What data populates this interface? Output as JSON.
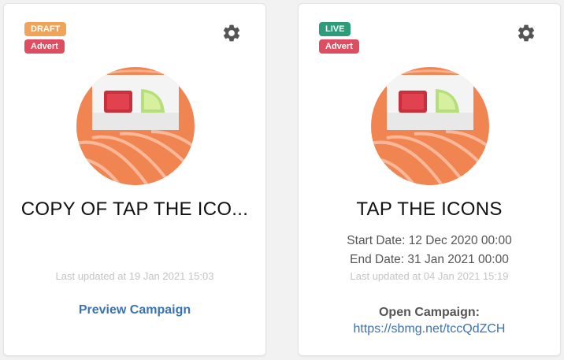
{
  "colors": {
    "draft_badge": "#f0a45a",
    "live_badge": "#2e9c78",
    "advert_badge": "#dd4f60",
    "link": "#3a73b5",
    "salmon": "#f08552"
  },
  "cards": [
    {
      "status_badge": "DRAFT",
      "type_badge": "Advert",
      "icon": "gear-icon",
      "image": "sushi-roll-image",
      "title": "COPY OF TAP THE ICO...",
      "last_updated": "Last updated at 19 Jan 2021 15:03",
      "action_label": "Preview Campaign"
    },
    {
      "status_badge": "LIVE",
      "type_badge": "Advert",
      "icon": "gear-icon",
      "image": "sushi-roll-image",
      "title": "TAP THE ICONS",
      "start_date": "Start Date: 12 Dec 2020 00:00",
      "end_date": "End Date: 31 Jan 2021 00:00",
      "last_updated": "Last updated at 04 Jan 2021 15:19",
      "open_label": "Open Campaign:",
      "open_url": "https://sbmg.net/tccQdZCH"
    }
  ]
}
